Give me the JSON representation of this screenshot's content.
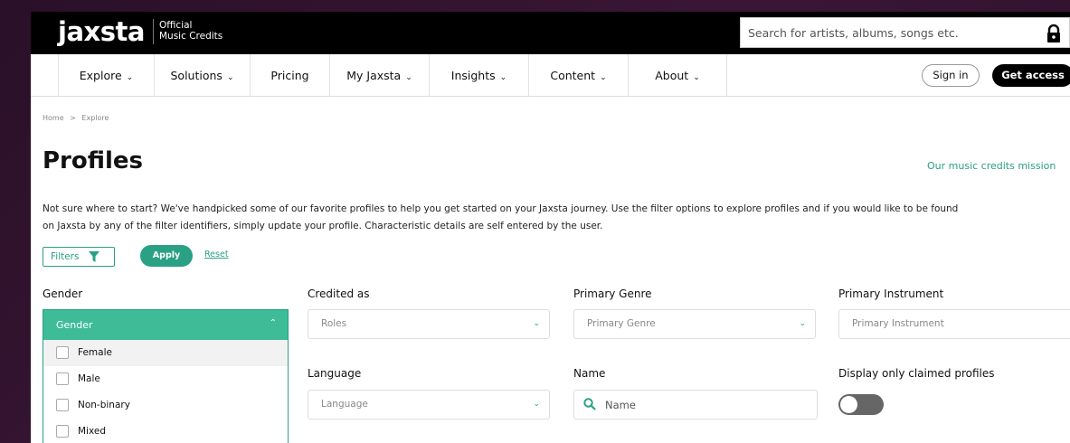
{
  "header": {
    "logo": "jaxsta",
    "tagline_line1": "Official",
    "tagline_line2": "Music Credits",
    "search_placeholder": "Search for artists, albums, songs etc."
  },
  "nav": {
    "items": [
      {
        "label": "Explore",
        "chevron": true
      },
      {
        "label": "Solutions",
        "chevron": true
      },
      {
        "label": "Pricing",
        "chevron": false
      },
      {
        "label": "My Jaxsta",
        "chevron": true
      },
      {
        "label": "Insights",
        "chevron": true
      },
      {
        "label": "Content",
        "chevron": true
      },
      {
        "label": "About",
        "chevron": true
      }
    ],
    "sign_in": "Sign in",
    "get_access": "Get access"
  },
  "breadcrumb": {
    "home": "Home",
    "sep": ">",
    "current": "Explore"
  },
  "page": {
    "title": "Profiles",
    "mission_link": "Our music credits mission",
    "description_line1": "Not sure where to start? We've handpicked some of our favorite profiles to help you get started on your Jaxsta journey. Use the filter options to explore profiles and if you would like to be found",
    "description_line2": "on Jaxsta by any of the filter identifiers, simply update your profile. Characteristic details are self entered by the user."
  },
  "filter_bar": {
    "filters": "Filters",
    "apply": "Apply",
    "reset": "Reset"
  },
  "filters": {
    "gender": {
      "label": "Gender",
      "input_value": "Gender",
      "options": [
        "Female",
        "Male",
        "Non-binary",
        "Mixed"
      ]
    },
    "credited_as": {
      "label": "Credited as",
      "placeholder": "Roles"
    },
    "primary_genre": {
      "label": "Primary Genre",
      "placeholder": "Primary Genre"
    },
    "primary_instrument": {
      "label": "Primary Instrument",
      "placeholder": "Primary Instrument"
    },
    "language": {
      "label": "Language",
      "placeholder": "Language"
    },
    "name": {
      "label": "Name",
      "placeholder": "Name"
    },
    "claimed": {
      "label": "Display only claimed profiles",
      "enabled": false
    }
  },
  "colors": {
    "accent": "#2aa084",
    "accent_light": "#3dbc97",
    "header_bg": "#000000"
  },
  "icons": [
    "lock-icon",
    "chevron-down-icon",
    "chevron-up-icon",
    "funnel-icon",
    "search-icon"
  ]
}
